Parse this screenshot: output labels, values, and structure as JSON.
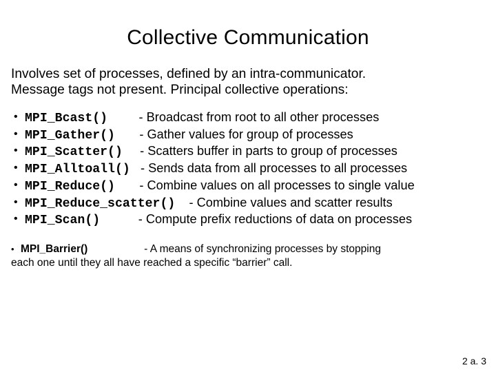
{
  "title": "Collective Communication",
  "intro_line1": "Involves set of processes, defined by an intra-communicator.",
  "intro_line2": "Message tags not present. Principal collective operations:",
  "items": [
    {
      "code": "MPI_Bcast()",
      "desc": "- Broadcast from root to all other processes"
    },
    {
      "code": "MPI_Gather()",
      "desc": "- Gather values for group of processes"
    },
    {
      "code": "MPI_Scatter()",
      "desc": "- Scatters buffer in parts to group of processes"
    },
    {
      "code": "MPI_Alltoall()",
      "desc": "- Sends data from all processes to all processes"
    },
    {
      "code": "MPI_Reduce()",
      "desc": "- Combine values on all processes to single value"
    },
    {
      "code": "MPI_Reduce_scatter()",
      "desc": "- Combine values and scatter results"
    },
    {
      "code": "MPI_Scan()",
      "desc": "- Compute prefix reductions of data on processes"
    }
  ],
  "gaps": [
    "         ",
    "       ",
    "     ",
    "   ",
    "       ",
    "    ",
    "           "
  ],
  "sub": {
    "code": "MPI_Barrier()",
    "gap": "                   ",
    "desc_line1": "- A means of synchronizing processes by stopping",
    "desc_line2": "each one until they all have reached a specific “barrier” call."
  },
  "pagenum": "2 a. 3"
}
